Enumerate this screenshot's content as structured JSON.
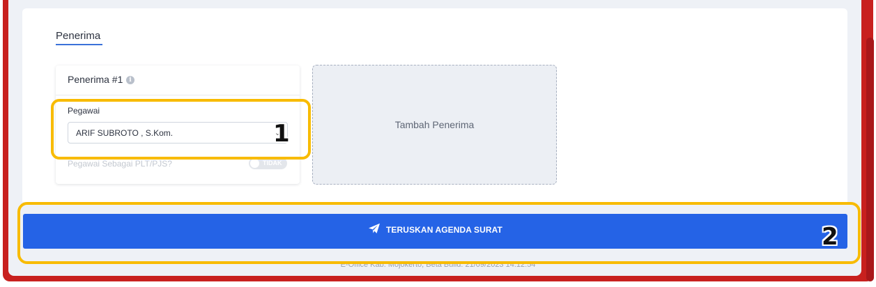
{
  "section": {
    "title": "Penerima"
  },
  "recipient": {
    "title": "Penerima #1",
    "info_icon": "info-icon",
    "employee_label": "Pegawai",
    "employee_value": "ARIF SUBROTO , S.Kom.",
    "plt_label": "Pegawai Sebagai PLT/PJS?",
    "plt_toggle_text": "TIDAK"
  },
  "add_recipient": {
    "label": "Tambah Penerima"
  },
  "forward_button": {
    "label": "TERUSKAN AGENDA SURAT",
    "icon": "paper-plane-icon"
  },
  "footer": {
    "text": "E-Office Kab. Mojokerto, Beta Build: 21/09/2023 14:12:54"
  },
  "markers": [
    "1",
    "2"
  ],
  "colors": {
    "accent_blue": "#2563e6",
    "highlight": "#f8bb00",
    "frame_red": "#c8201e"
  }
}
